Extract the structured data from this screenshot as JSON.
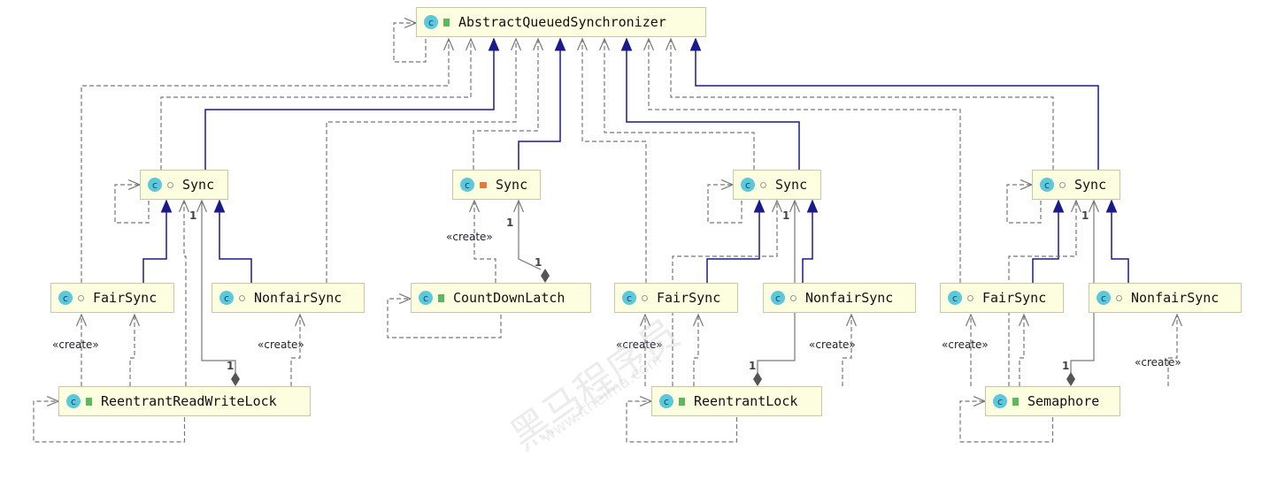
{
  "nodes": {
    "aqs": {
      "label": "AbstractQueuedSynchronizer",
      "access": "public"
    },
    "rrwl_sync": {
      "label": "Sync",
      "access": "package"
    },
    "rrwl_fair": {
      "label": "FairSync",
      "access": "package"
    },
    "rrwl_nonfair": {
      "label": "NonfairSync",
      "access": "package"
    },
    "rrwl": {
      "label": "ReentrantReadWriteLock",
      "access": "public"
    },
    "cdl_sync": {
      "label": "Sync",
      "access": "private"
    },
    "cdl": {
      "label": "CountDownLatch",
      "access": "public"
    },
    "rl_sync": {
      "label": "Sync",
      "access": "package"
    },
    "rl_fair": {
      "label": "FairSync",
      "access": "package"
    },
    "rl_nonfair": {
      "label": "NonfairSync",
      "access": "package"
    },
    "rl": {
      "label": "ReentrantLock",
      "access": "public"
    },
    "sem_sync": {
      "label": "Sync",
      "access": "package"
    },
    "sem_fair": {
      "label": "FairSync",
      "access": "package"
    },
    "sem_nonfair": {
      "label": "NonfairSync",
      "access": "package"
    },
    "sem": {
      "label": "Semaphore",
      "access": "public"
    }
  },
  "labels": {
    "create": "«create»",
    "one": "1",
    "class_icon": "c"
  },
  "colors": {
    "inheritance": "#1a1a8c",
    "dependency": "#777777",
    "node_fill": "#fdfde0"
  },
  "watermark": {
    "brand": "黑马程序员",
    "url": "www.itheima.com"
  }
}
